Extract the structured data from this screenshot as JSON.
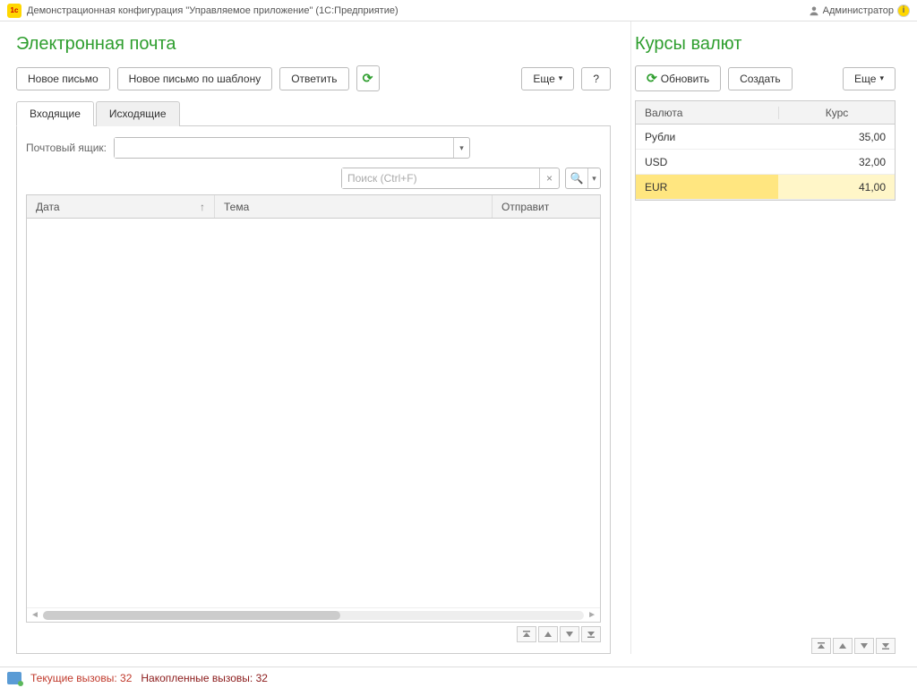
{
  "titlebar": {
    "app_title": "Демонстрационная конфигурация \"Управляемое приложение\"  (1С:Предприятие)",
    "user_name": "Администратор"
  },
  "email": {
    "title": "Электронная почта",
    "toolbar": {
      "new_message": "Новое письмо",
      "new_template": "Новое письмо по шаблону",
      "reply": "Ответить",
      "more": "Еще",
      "help": "?"
    },
    "tabs": {
      "inbox": "Входящие",
      "outbox": "Исходящие"
    },
    "mailbox_label": "Почтовый ящик:",
    "mailbox_value": "",
    "search_placeholder": "Поиск (Ctrl+F)",
    "columns": {
      "date": "Дата",
      "subject": "Тема",
      "sender": "Отправит"
    }
  },
  "rates": {
    "title": "Курсы валют",
    "toolbar": {
      "refresh": "Обновить",
      "create": "Создать",
      "more": "Еще"
    },
    "columns": {
      "currency": "Валюта",
      "rate": "Курс"
    },
    "rows": [
      {
        "currency": "Рубли",
        "rate": "35,00"
      },
      {
        "currency": "USD",
        "rate": "32,00"
      },
      {
        "currency": "EUR",
        "rate": "41,00"
      }
    ],
    "selected_index": 2
  },
  "statusbar": {
    "current_calls_label": "Текущие вызовы:",
    "current_calls_value": "32",
    "accumulated_label": "Накопленные вызовы:",
    "accumulated_value": "32"
  }
}
